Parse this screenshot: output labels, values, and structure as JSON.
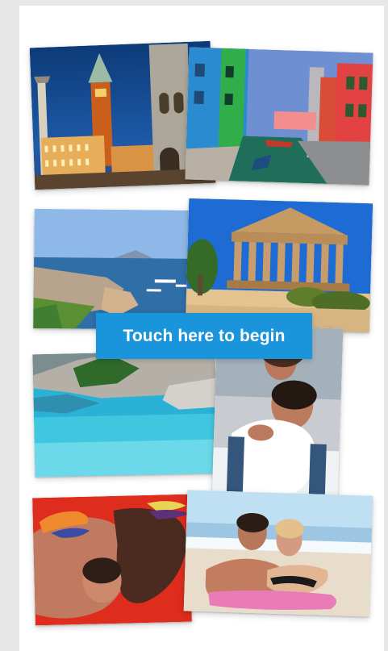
{
  "cta": {
    "label": "Touch here to begin"
  }
}
